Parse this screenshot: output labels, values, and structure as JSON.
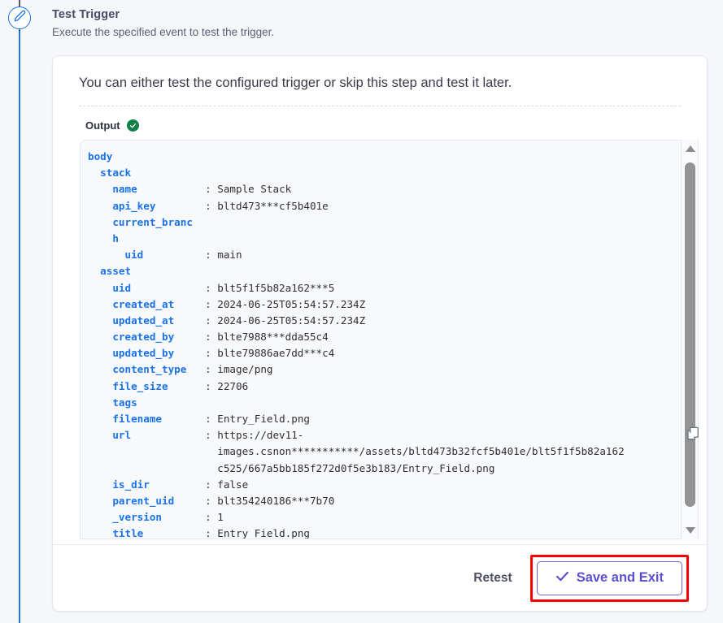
{
  "section": {
    "title": "Test Trigger",
    "subtitle": "Execute the specified event to test the trigger."
  },
  "card": {
    "intro": "You can either test the configured trigger or skip this step and test it later.",
    "output_label": "Output",
    "status_icon": "check-circle-icon",
    "status_color": "#108048"
  },
  "code_viewer": {
    "copy_icon": "copy-icon",
    "scroll_up_icon": "triangle-up-icon",
    "scroll_down_icon": "triangle-down-icon",
    "lines": [
      {
        "indent": 1,
        "key": "body",
        "sep": "",
        "value": ""
      },
      {
        "indent": 2,
        "key": "stack",
        "sep": "",
        "value": ""
      },
      {
        "indent": 3,
        "key": "name",
        "sep": ":",
        "value": "Sample Stack"
      },
      {
        "indent": 3,
        "key": "api_key",
        "sep": ":",
        "value": "bltd473***cf5b401e"
      },
      {
        "indent": 3,
        "key": "current_branc",
        "sep": "",
        "value": ""
      },
      {
        "indent": 3,
        "key": "h",
        "sep": "",
        "value": ""
      },
      {
        "indent": 4,
        "key": "uid",
        "sep": ":",
        "value": "main"
      },
      {
        "indent": 2,
        "key": "asset",
        "sep": "",
        "value": ""
      },
      {
        "indent": 3,
        "key": "uid",
        "sep": ":",
        "value": "blt5f1f5b82a162***5"
      },
      {
        "indent": 3,
        "key": "created_at",
        "sep": ":",
        "value": "2024-06-25T05:54:57.234Z"
      },
      {
        "indent": 3,
        "key": "updated_at",
        "sep": ":",
        "value": "2024-06-25T05:54:57.234Z"
      },
      {
        "indent": 3,
        "key": "created_by",
        "sep": ":",
        "value": "blte7988***dda55c4"
      },
      {
        "indent": 3,
        "key": "updated_by",
        "sep": ":",
        "value": "blte79886ae7dd***c4"
      },
      {
        "indent": 3,
        "key": "content_type",
        "sep": ":",
        "value": "image/png"
      },
      {
        "indent": 3,
        "key": "file_size",
        "sep": ":",
        "value": "22706"
      },
      {
        "indent": 3,
        "key": "tags",
        "sep": "",
        "value": ""
      },
      {
        "indent": 3,
        "key": "filename",
        "sep": ":",
        "value": "Entry_Field.png"
      },
      {
        "indent": 3,
        "key": "url",
        "sep": ":",
        "value": "https://dev11-"
      },
      {
        "indent": 0,
        "key": "",
        "sep": "",
        "value": "images.csnon***********/assets/bltd473b32fcf5b401e/blt5f1f5b82a162",
        "cont": true
      },
      {
        "indent": 0,
        "key": "",
        "sep": "",
        "value": "c525/667a5bb185f272d0f5e3b183/Entry_Field.png",
        "cont": true
      },
      {
        "indent": 3,
        "key": "is_dir",
        "sep": ":",
        "value": "false"
      },
      {
        "indent": 3,
        "key": "parent_uid",
        "sep": ":",
        "value": "blt354240186***7b70"
      },
      {
        "indent": 3,
        "key": "_version",
        "sep": ":",
        "value": "1"
      },
      {
        "indent": 3,
        "key": "title",
        "sep": ":",
        "value": "Entry_Field.png"
      }
    ]
  },
  "footer": {
    "retest_label": "Retest",
    "save_label": "Save and Exit",
    "save_icon": "check-icon",
    "highlight_color": "#fa0000"
  },
  "rail": {
    "node_icon": "pencil-icon",
    "line_color": "#1a73e8"
  }
}
